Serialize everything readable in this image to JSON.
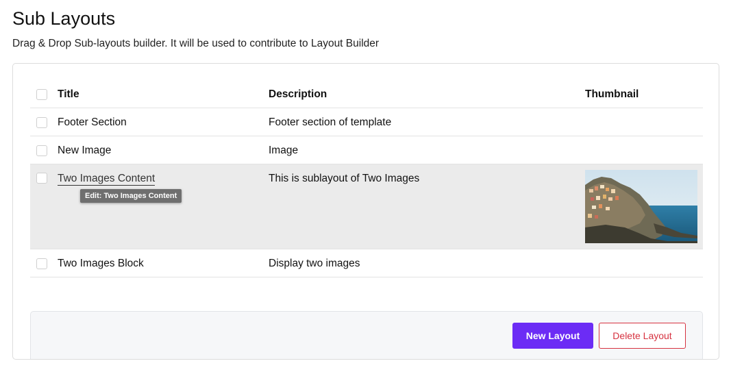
{
  "page": {
    "title": "Sub Layouts",
    "subtitle": "Drag & Drop Sub-layouts builder. It will be used to contribute to Layout Builder"
  },
  "table": {
    "headers": {
      "title": "Title",
      "description": "Description",
      "thumbnail": "Thumbnail"
    },
    "rows": [
      {
        "title": "Footer Section",
        "description": "Footer section of template",
        "has_thumbnail": false
      },
      {
        "title": "New Image",
        "description": "Image",
        "has_thumbnail": false
      },
      {
        "title": "Two Images Content",
        "description": "This is sublayout of Two Images",
        "has_thumbnail": true,
        "hovered": true,
        "tooltip": "Edit: Two Images Content"
      },
      {
        "title": "Two Images Block",
        "description": "Display two images",
        "has_thumbnail": false
      }
    ]
  },
  "actions": {
    "new_layout": "New Layout",
    "delete_layout": "Delete Layout"
  },
  "colors": {
    "primary": "#6c2cf5",
    "danger": "#d6313f",
    "row_highlight": "#ebebeb"
  }
}
